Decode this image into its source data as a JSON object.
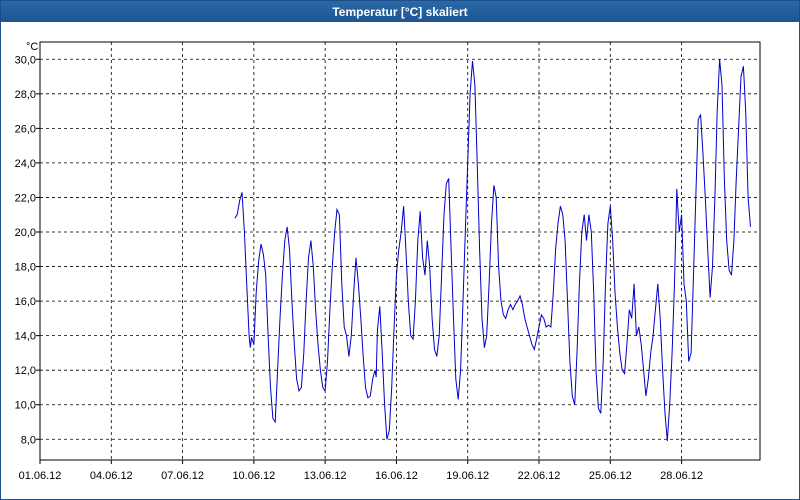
{
  "window": {
    "title": "Temperatur [°C] skaliert"
  },
  "colors": {
    "titlebar": "#1d5592",
    "line": "#0000c8",
    "grid": "#000000"
  },
  "chart_data": {
    "type": "line",
    "title": "Temperatur [°C] skaliert",
    "ylabel": "°C",
    "xlabel": "",
    "grid": true,
    "legend": "none",
    "x_tick_labels": [
      "01.06.12",
      "04.06.12",
      "07.06.12",
      "10.06.12",
      "13.06.12",
      "16.06.12",
      "19.06.12",
      "22.06.12",
      "25.06.12",
      "28.06.12"
    ],
    "y_tick_labels": [
      "8,0",
      "10,0",
      "12,0",
      "14,0",
      "16,0",
      "18,0",
      "20,0",
      "22,0",
      "24,0",
      "26,0",
      "28,0",
      "30,0"
    ],
    "xlim": [
      0,
      30.3
    ],
    "ylim": [
      6.8,
      31.0
    ],
    "series": [
      {
        "color": "#0000c8",
        "points": [
          [
            8.2,
            20.8
          ],
          [
            8.3,
            21.0
          ],
          [
            8.4,
            21.8
          ],
          [
            8.5,
            22.3
          ],
          [
            8.6,
            20.0
          ],
          [
            8.7,
            17.0
          ],
          [
            8.8,
            14.0
          ],
          [
            8.85,
            13.3
          ],
          [
            8.9,
            13.9
          ],
          [
            9.0,
            13.5
          ],
          [
            9.1,
            16.5
          ],
          [
            9.2,
            18.3
          ],
          [
            9.3,
            19.3
          ],
          [
            9.4,
            18.7
          ],
          [
            9.5,
            17.5
          ],
          [
            9.6,
            14.0
          ],
          [
            9.7,
            11.0
          ],
          [
            9.8,
            9.2
          ],
          [
            9.9,
            9.0
          ],
          [
            10.0,
            12.0
          ],
          [
            10.1,
            15.0
          ],
          [
            10.2,
            17.5
          ],
          [
            10.3,
            19.5
          ],
          [
            10.4,
            20.3
          ],
          [
            10.5,
            19.0
          ],
          [
            10.6,
            16.0
          ],
          [
            10.7,
            13.5
          ],
          [
            10.8,
            11.5
          ],
          [
            10.9,
            10.8
          ],
          [
            11.0,
            11.0
          ],
          [
            11.1,
            13.0
          ],
          [
            11.2,
            16.0
          ],
          [
            11.3,
            18.5
          ],
          [
            11.4,
            19.5
          ],
          [
            11.5,
            18.0
          ],
          [
            11.6,
            15.5
          ],
          [
            11.7,
            13.5
          ],
          [
            11.8,
            12.0
          ],
          [
            11.9,
            11.0
          ],
          [
            12.0,
            10.8
          ],
          [
            12.1,
            12.5
          ],
          [
            12.2,
            15.5
          ],
          [
            12.3,
            18.0
          ],
          [
            12.4,
            20.0
          ],
          [
            12.5,
            21.3
          ],
          [
            12.6,
            21.0
          ],
          [
            12.7,
            17.0
          ],
          [
            12.8,
            14.5
          ],
          [
            12.9,
            14.0
          ],
          [
            13.0,
            12.8
          ],
          [
            13.1,
            14.0
          ],
          [
            13.2,
            16.5
          ],
          [
            13.3,
            18.5
          ],
          [
            13.4,
            17.0
          ],
          [
            13.5,
            15.0
          ],
          [
            13.6,
            12.8
          ],
          [
            13.7,
            11.0
          ],
          [
            13.8,
            10.4
          ],
          [
            13.9,
            10.5
          ],
          [
            14.0,
            11.5
          ],
          [
            14.1,
            12.0
          ],
          [
            14.15,
            11.6
          ],
          [
            14.2,
            14.3
          ],
          [
            14.3,
            15.7
          ],
          [
            14.4,
            13.0
          ],
          [
            14.5,
            10.0
          ],
          [
            14.6,
            8.0
          ],
          [
            14.7,
            8.5
          ],
          [
            14.8,
            11.0
          ],
          [
            14.9,
            14.5
          ],
          [
            15.0,
            17.5
          ],
          [
            15.1,
            19.0
          ],
          [
            15.2,
            20.0
          ],
          [
            15.3,
            21.5
          ],
          [
            15.4,
            19.0
          ],
          [
            15.5,
            16.0
          ],
          [
            15.6,
            14.0
          ],
          [
            15.7,
            13.8
          ],
          [
            15.8,
            16.0
          ],
          [
            15.9,
            19.5
          ],
          [
            16.0,
            21.2
          ],
          [
            16.1,
            18.5
          ],
          [
            16.2,
            17.5
          ],
          [
            16.3,
            19.5
          ],
          [
            16.4,
            18.0
          ],
          [
            16.5,
            15.0
          ],
          [
            16.6,
            13.2
          ],
          [
            16.7,
            12.8
          ],
          [
            16.8,
            14.0
          ],
          [
            16.9,
            17.5
          ],
          [
            17.0,
            21.0
          ],
          [
            17.1,
            22.8
          ],
          [
            17.2,
            23.1
          ],
          [
            17.3,
            19.0
          ],
          [
            17.4,
            15.0
          ],
          [
            17.5,
            11.5
          ],
          [
            17.6,
            10.3
          ],
          [
            17.7,
            12.0
          ],
          [
            17.8,
            16.0
          ],
          [
            17.9,
            20.0
          ],
          [
            18.0,
            24.0
          ],
          [
            18.1,
            28.0
          ],
          [
            18.2,
            29.9
          ],
          [
            18.3,
            28.5
          ],
          [
            18.4,
            24.0
          ],
          [
            18.5,
            19.0
          ],
          [
            18.6,
            15.0
          ],
          [
            18.7,
            13.3
          ],
          [
            18.8,
            14.0
          ],
          [
            18.9,
            17.0
          ],
          [
            19.0,
            20.5
          ],
          [
            19.1,
            22.7
          ],
          [
            19.2,
            22.0
          ],
          [
            19.3,
            18.0
          ],
          [
            19.4,
            16.0
          ],
          [
            19.5,
            15.2
          ],
          [
            19.6,
            15.0
          ],
          [
            19.7,
            15.5
          ],
          [
            19.8,
            15.8
          ],
          [
            19.9,
            15.5
          ],
          [
            20.0,
            15.8
          ],
          [
            20.1,
            16.0
          ],
          [
            20.2,
            16.3
          ],
          [
            20.3,
            15.8
          ],
          [
            20.4,
            15.0
          ],
          [
            20.5,
            14.5
          ],
          [
            20.6,
            14.0
          ],
          [
            20.7,
            13.5
          ],
          [
            20.8,
            13.2
          ],
          [
            20.9,
            13.8
          ],
          [
            21.0,
            14.5
          ],
          [
            21.1,
            15.2
          ],
          [
            21.2,
            15.0
          ],
          [
            21.3,
            14.5
          ],
          [
            21.4,
            14.6
          ],
          [
            21.5,
            14.5
          ],
          [
            21.6,
            16.5
          ],
          [
            21.7,
            19.0
          ],
          [
            21.8,
            20.5
          ],
          [
            21.9,
            21.5
          ],
          [
            22.0,
            21.0
          ],
          [
            22.1,
            19.5
          ],
          [
            22.2,
            16.0
          ],
          [
            22.3,
            12.5
          ],
          [
            22.4,
            10.5
          ],
          [
            22.5,
            10.0
          ],
          [
            22.6,
            13.0
          ],
          [
            22.7,
            17.0
          ],
          [
            22.8,
            20.0
          ],
          [
            22.9,
            21.0
          ],
          [
            23.0,
            19.5
          ],
          [
            23.1,
            21.0
          ],
          [
            23.2,
            20.0
          ],
          [
            23.3,
            16.5
          ],
          [
            23.4,
            12.0
          ],
          [
            23.5,
            9.8
          ],
          [
            23.6,
            9.5
          ],
          [
            23.7,
            12.5
          ],
          [
            23.8,
            17.0
          ],
          [
            23.9,
            20.5
          ],
          [
            24.0,
            21.5
          ],
          [
            24.1,
            19.5
          ],
          [
            24.2,
            16.5
          ],
          [
            24.3,
            14.5
          ],
          [
            24.4,
            13.0
          ],
          [
            24.5,
            12.0
          ],
          [
            24.6,
            11.8
          ],
          [
            24.7,
            13.5
          ],
          [
            24.8,
            15.5
          ],
          [
            24.9,
            15.0
          ],
          [
            25.0,
            17.0
          ],
          [
            25.1,
            14.0
          ],
          [
            25.2,
            14.5
          ],
          [
            25.3,
            13.5
          ],
          [
            25.4,
            12.0
          ],
          [
            25.5,
            10.5
          ],
          [
            25.6,
            11.5
          ],
          [
            25.7,
            13.0
          ],
          [
            25.8,
            14.0
          ],
          [
            25.9,
            15.5
          ],
          [
            26.0,
            17.0
          ],
          [
            26.1,
            15.0
          ],
          [
            26.2,
            12.0
          ],
          [
            26.3,
            9.5
          ],
          [
            26.4,
            7.9
          ],
          [
            26.5,
            10.0
          ],
          [
            26.6,
            13.0
          ],
          [
            26.7,
            17.0
          ],
          [
            26.8,
            22.5
          ],
          [
            26.9,
            20.0
          ],
          [
            27.0,
            21.0
          ],
          [
            27.1,
            17.0
          ],
          [
            27.2,
            16.0
          ],
          [
            27.3,
            12.5
          ],
          [
            27.4,
            13.0
          ],
          [
            27.5,
            17.5
          ],
          [
            27.6,
            22.0
          ],
          [
            27.7,
            26.5
          ],
          [
            27.8,
            26.8
          ],
          [
            27.9,
            24.5
          ],
          [
            28.0,
            22.0
          ],
          [
            28.1,
            19.0
          ],
          [
            28.2,
            16.2
          ],
          [
            28.3,
            18.0
          ],
          [
            28.4,
            22.0
          ],
          [
            28.5,
            27.0
          ],
          [
            28.6,
            30.0
          ],
          [
            28.7,
            28.5
          ],
          [
            28.8,
            23.0
          ],
          [
            28.9,
            19.5
          ],
          [
            29.0,
            17.8
          ],
          [
            29.1,
            17.5
          ],
          [
            29.2,
            19.5
          ],
          [
            29.3,
            23.0
          ],
          [
            29.4,
            26.0
          ],
          [
            29.5,
            29.0
          ],
          [
            29.6,
            29.6
          ],
          [
            29.7,
            27.0
          ],
          [
            29.8,
            22.0
          ],
          [
            29.9,
            20.3
          ]
        ]
      }
    ]
  }
}
